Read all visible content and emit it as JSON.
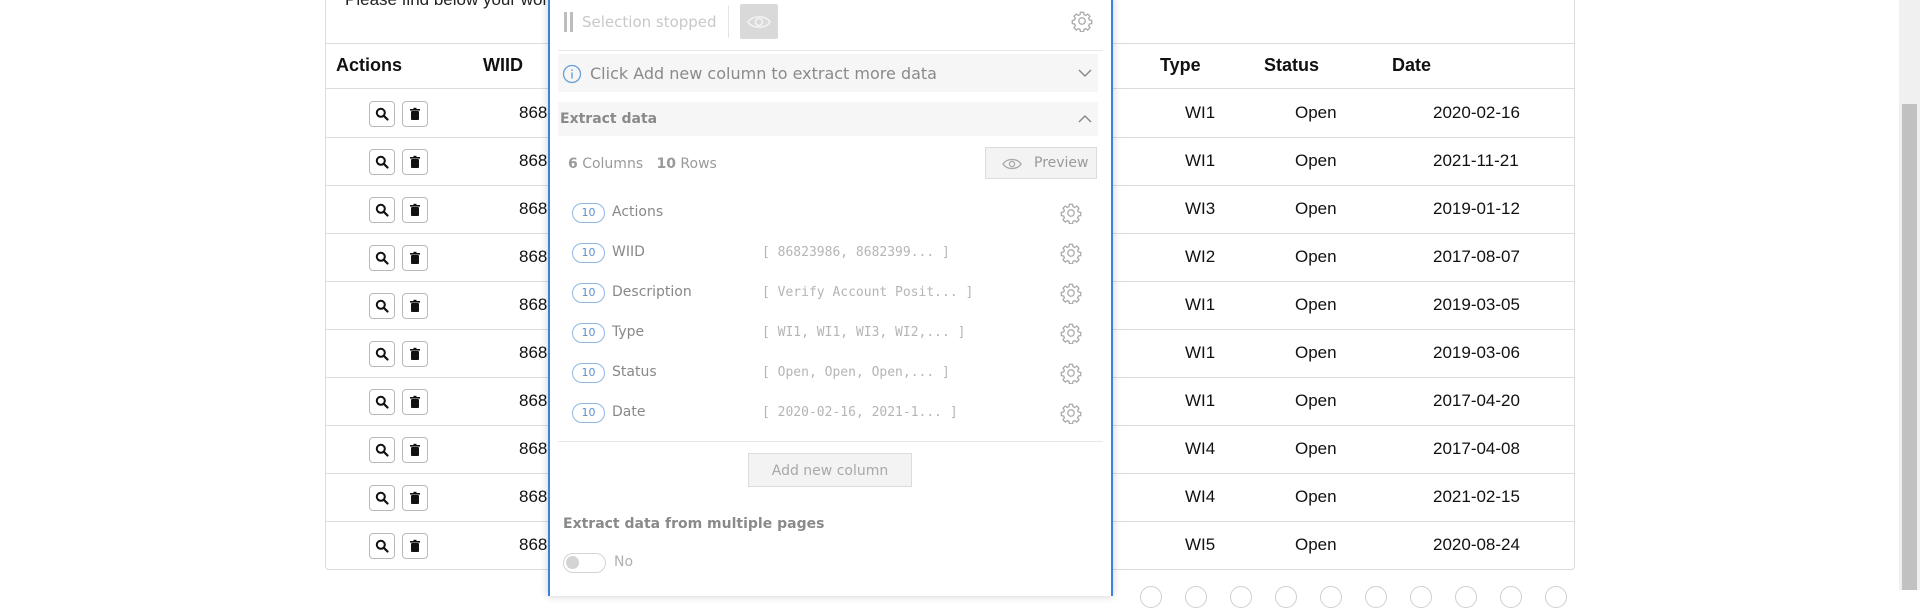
{
  "page": {
    "intro_text": "Please find below your work items assigned to you by your manager.",
    "table": {
      "headers": [
        "Actions",
        "WIID",
        "Type",
        "Status",
        "Date"
      ],
      "rows": [
        {
          "wiid": "868",
          "type": "WI1",
          "status": "Open",
          "date": "2020-02-16"
        },
        {
          "wiid": "868",
          "type": "WI1",
          "status": "Open",
          "date": "2021-11-21"
        },
        {
          "wiid": "868",
          "type": "WI3",
          "status": "Open",
          "date": "2019-01-12"
        },
        {
          "wiid": "868",
          "type": "WI2",
          "status": "Open",
          "date": "2017-08-07"
        },
        {
          "wiid": "868",
          "type": "WI1",
          "status": "Open",
          "date": "2019-03-05"
        },
        {
          "wiid": "868",
          "type": "WI1",
          "status": "Open",
          "date": "2019-03-06"
        },
        {
          "wiid": "868",
          "type": "WI1",
          "status": "Open",
          "date": "2017-04-20"
        },
        {
          "wiid": "868",
          "type": "WI4",
          "status": "Open",
          "date": "2017-04-08"
        },
        {
          "wiid": "868",
          "type": "WI4",
          "status": "Open",
          "date": "2021-02-15"
        },
        {
          "wiid": "868",
          "type": "WI5",
          "status": "Open",
          "date": "2020-08-24"
        }
      ],
      "row_icons": [
        "search-icon",
        "trash-icon"
      ]
    }
  },
  "panel": {
    "selection_status": "Selection stopped",
    "info_banner": "Click Add new column to extract more data",
    "extract_header": "Extract data",
    "summary": {
      "columns_count": "6",
      "columns_label": "Columns",
      "rows_count": "10",
      "rows_label": "Rows"
    },
    "preview_label": "Preview",
    "columns": [
      {
        "count": "10",
        "name": "Actions",
        "preview": ""
      },
      {
        "count": "10",
        "name": "WIID",
        "preview": "[ 86823986, 8682399... ]"
      },
      {
        "count": "10",
        "name": "Description",
        "preview": "[ Verify Account Posit... ]"
      },
      {
        "count": "10",
        "name": "Type",
        "preview": "[ WI1, WI1, WI3, WI2,... ]"
      },
      {
        "count": "10",
        "name": "Status",
        "preview": "[ Open, Open, Open,... ]"
      },
      {
        "count": "10",
        "name": "Date",
        "preview": "[ 2020-02-16, 2021-1... ]"
      }
    ],
    "add_column_label": "Add new column",
    "multi_page_label": "Extract data from multiple pages",
    "multi_page_value": "No",
    "colors": {
      "accent": "#3b82d9",
      "badge": "#5b8fc9"
    }
  }
}
